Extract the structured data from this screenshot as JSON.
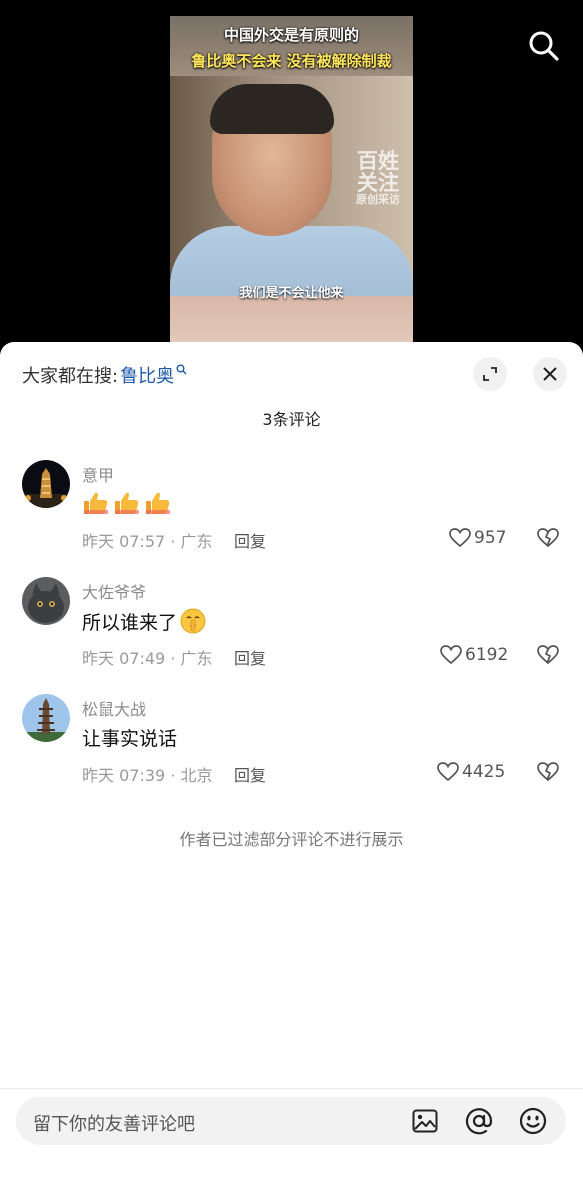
{
  "video": {
    "title_line1": "中国外交是有原则的",
    "title_line2": "鲁比奥不会来 没有被解除制裁",
    "watermark_line1": "百姓",
    "watermark_line2": "关注",
    "watermark_line3": "原创采访",
    "subtitle": "我们是不会让他来"
  },
  "sheet": {
    "search_prefix": "大家都在搜:",
    "search_keyword": "鲁比奥",
    "comment_count": "3条评论",
    "filter_note": "作者已过滤部分评论不进行展示"
  },
  "comments": [
    {
      "user": "意甲",
      "text": "",
      "emoji": [
        "thumbs-up",
        "thumbs-up",
        "thumbs-up"
      ],
      "time": "昨天 07:57 · 广东",
      "reply": "回复",
      "likes": "957"
    },
    {
      "user": "大佐爷爷",
      "text": "所以谁来了",
      "emoji": [
        "shush-face"
      ],
      "time": "昨天 07:49 · 广东",
      "reply": "回复",
      "likes": "6192"
    },
    {
      "user": "松鼠大战",
      "text": "让事实说话",
      "emoji": [],
      "time": "昨天 07:39 · 北京",
      "reply": "回复",
      "likes": "4425"
    }
  ],
  "input": {
    "placeholder": "留下你的友善评论吧"
  },
  "icons": {
    "search": "search-icon",
    "expand": "expand-icon",
    "close": "close-icon",
    "like": "heart-icon",
    "dislike": "broken-heart-icon",
    "image": "image-icon",
    "mention": "at-icon",
    "emoji": "emoji-icon"
  },
  "colors": {
    "keyword": "#1e5aa8",
    "title_highlight": "#ffe65c"
  }
}
